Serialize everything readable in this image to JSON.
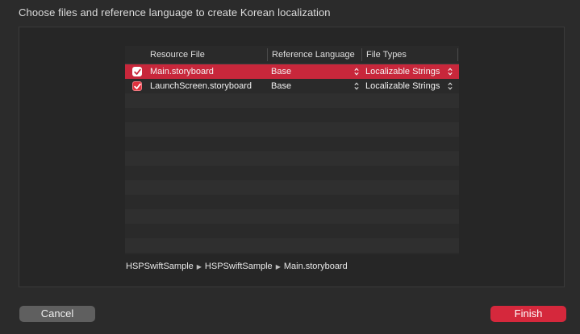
{
  "dialog": {
    "title": "Choose files and reference language to create Korean localization"
  },
  "table": {
    "columns": [
      "Resource File",
      "Reference Language",
      "File Types"
    ],
    "rows": [
      {
        "checked": true,
        "file": "Main.storyboard",
        "language": "Base",
        "type": "Localizable Strings",
        "selected": true
      },
      {
        "checked": true,
        "file": "LaunchScreen.storyboard",
        "language": "Base",
        "type": "Localizable Strings",
        "selected": false
      }
    ]
  },
  "breadcrumb": [
    "HSPSwiftSample",
    "HSPSwiftSample",
    "Main.storyboard"
  ],
  "buttons": {
    "cancel": "Cancel",
    "finish": "Finish"
  },
  "colors": {
    "accent": "#d5283c",
    "selected_row": "#c8273b",
    "background": "#2b2b2b"
  },
  "icons": {
    "checkbox": "checkmark-icon",
    "popup": "chevron-updown-icon",
    "breadcrumb_separator": "triangle-right-icon"
  }
}
